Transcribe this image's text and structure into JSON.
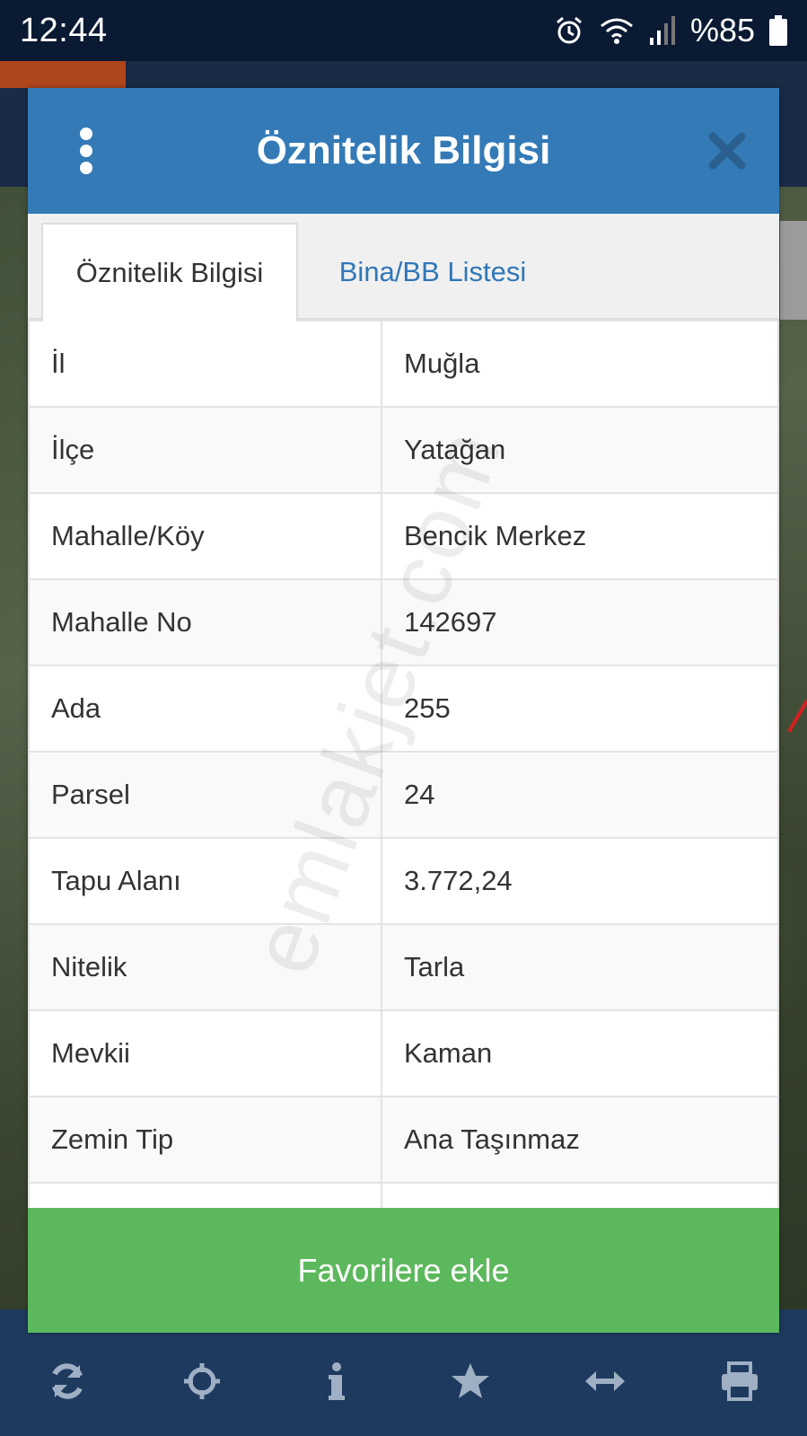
{
  "status_bar": {
    "time": "12:44",
    "battery": "%85"
  },
  "modal": {
    "title": "Öznitelik Bilgisi",
    "tabs": [
      {
        "label": "Öznitelik Bilgisi",
        "active": true
      },
      {
        "label": "Bina/BB Listesi",
        "active": false
      }
    ],
    "rows": [
      {
        "key": "İl",
        "value": "Muğla"
      },
      {
        "key": "İlçe",
        "value": "Yatağan"
      },
      {
        "key": "Mahalle/Köy",
        "value": "Bencik Merkez"
      },
      {
        "key": "Mahalle No",
        "value": "142697"
      },
      {
        "key": "Ada",
        "value": "255"
      },
      {
        "key": "Parsel",
        "value": "24"
      },
      {
        "key": "Tapu Alanı",
        "value": "3.772,24"
      },
      {
        "key": "Nitelik",
        "value": "Tarla"
      },
      {
        "key": "Mevkii",
        "value": "Kaman"
      },
      {
        "key": "Zemin Tip",
        "value": "Ana Taşınmaz"
      },
      {
        "key": "",
        "value": ""
      }
    ],
    "favorite_button_label": "Favorilere ekle"
  },
  "watermark": "emlakjet.com",
  "toolbar": {
    "icons": [
      "refresh-icon",
      "locate-icon",
      "info-icon",
      "star-icon",
      "measure-icon",
      "print-icon"
    ]
  },
  "colors": {
    "header_blue": "#337ab7",
    "tab_link_blue": "#2f77b8",
    "button_green": "#5cb85c",
    "toolbar_navy": "#1e3a5f",
    "statusbar_navy": "#0b1a33"
  }
}
